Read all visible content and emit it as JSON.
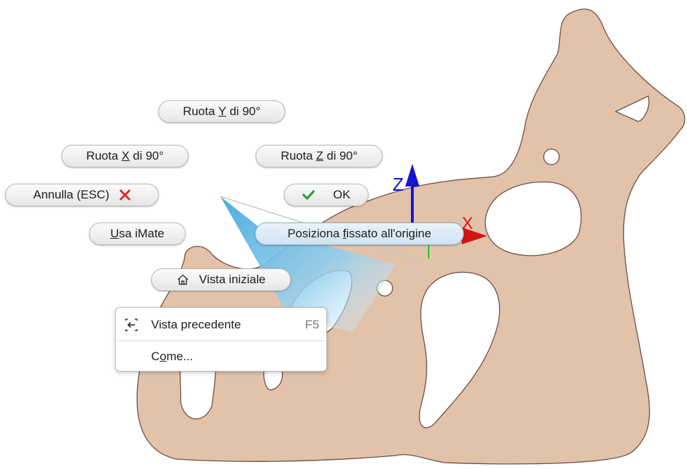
{
  "marking_menu": {
    "rotate_y": {
      "pre": "Ruota ",
      "key": "Y",
      "post": " di 90°"
    },
    "rotate_x": {
      "pre": "Ruota ",
      "key": "X",
      "post": " di 90°"
    },
    "rotate_z": {
      "pre": "Ruota ",
      "key": "Z",
      "post": " di 90°"
    },
    "cancel": {
      "label": "Annulla (ESC)",
      "icon": "close-icon",
      "icon_color": "#e0282e"
    },
    "ok": {
      "label": "OK",
      "icon": "checkmark-icon",
      "icon_color": "#2e9e3a"
    },
    "use_imate": {
      "key": "U",
      "post": "sa iMate"
    },
    "place_grounded": {
      "pre": "Posiziona ",
      "key": "f",
      "post": "issato all'origine"
    },
    "home_view": {
      "label": "Vista iniziale",
      "icon": "home-icon"
    }
  },
  "overflow_menu": {
    "previous_view": {
      "label": "Vista precedente",
      "shortcut": "F5",
      "icon": "previous-view-icon"
    },
    "how_to": {
      "pre": "C",
      "key": "o",
      "post": "me..."
    }
  },
  "triad": {
    "z_label": "Z",
    "x_label": "X",
    "z_color": "#1414d2",
    "x_color": "#d21414",
    "y_color": "#22cc22"
  },
  "colors": {
    "part_fill": "#e3c2aa",
    "part_edge": "#6b5043",
    "highlight": "#3ea8de"
  }
}
